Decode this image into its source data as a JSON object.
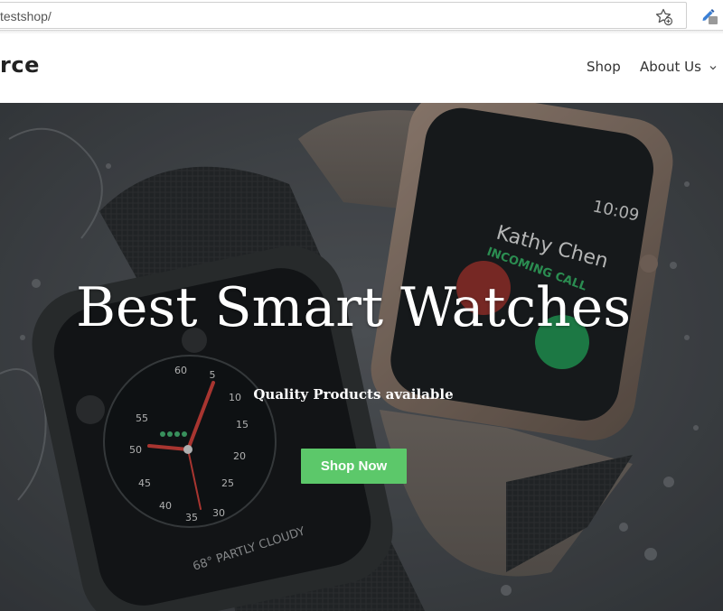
{
  "browser": {
    "url": "testshop/",
    "bookmark_icon": "star-add-icon",
    "extension_icon": "pen-extension-icon"
  },
  "header": {
    "logo": "rce",
    "nav": {
      "shop": "Shop",
      "about": "About Us"
    }
  },
  "hero": {
    "title": "Best Smart Watches",
    "subtitle": "Quality Products available",
    "cta": "Shop Now",
    "colors": {
      "cta_bg": "#5cc86a",
      "overlay": "#3b3e42"
    },
    "watch_left": {
      "complication_text": "68° PARTLY CLOUDY",
      "dial_numbers": [
        "60",
        "5",
        "10",
        "15",
        "20",
        "25",
        "30",
        "35",
        "40",
        "45",
        "50",
        "55"
      ]
    },
    "watch_right": {
      "time": "10:09",
      "caller": "Kathy Chen",
      "status": "INCOMING CALL"
    }
  }
}
